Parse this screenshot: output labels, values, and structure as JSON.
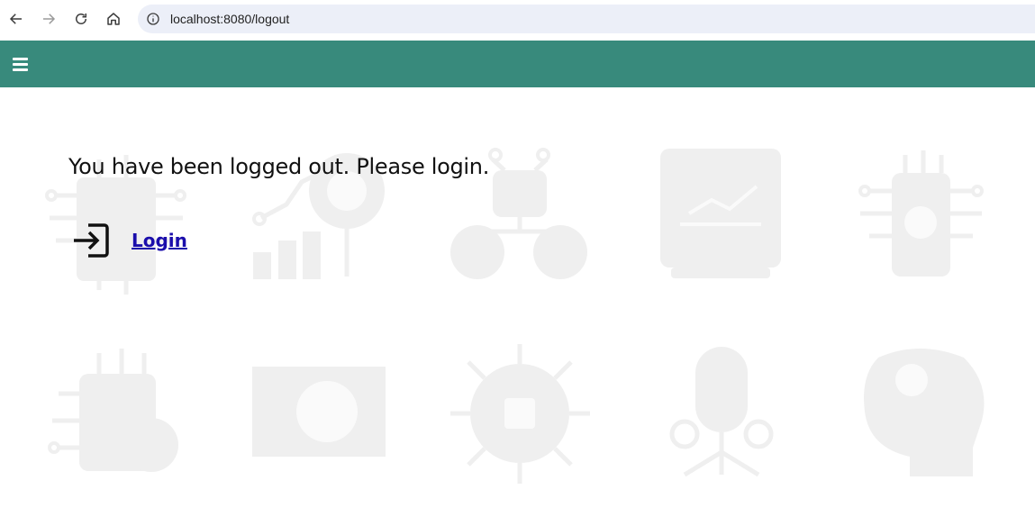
{
  "browser": {
    "url": "localhost:8080/logout"
  },
  "header": {
    "background_color": "#388a7c",
    "menu_icon": "hamburger-menu-icon"
  },
  "main": {
    "message": "You have been logged out. Please login.",
    "login_link_label": "Login",
    "login_icon": "login-enter-icon",
    "background_icons": [
      "circuit-chip-icon",
      "analytics-brain-icon",
      "robot-network-icon",
      "monitor-chart-icon",
      "circuit-lightbulb-icon",
      "circuit-document-icon",
      "screen-pie-icon",
      "virus-chip-icon",
      "ai-microphone-icon",
      "head-gears-icon"
    ]
  }
}
